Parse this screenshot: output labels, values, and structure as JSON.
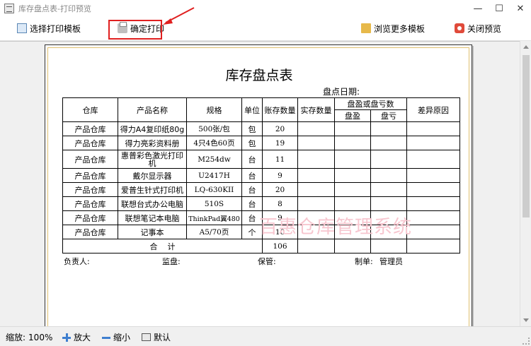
{
  "window": {
    "title": "库存盘点表-打印预览",
    "minimize": "—",
    "maximize": "☐",
    "close": "✕"
  },
  "toolbar": {
    "select_template": "选择打印模板",
    "confirm_print": "确定打印",
    "browse_templates": "浏览更多模板",
    "close_preview": "关闭预览"
  },
  "document": {
    "title": "库存盘点表",
    "date_label": "盘点日期:",
    "headers": {
      "warehouse": "仓库",
      "product": "产品名称",
      "spec": "规格",
      "unit": "单位",
      "book_qty": "账存数量",
      "actual_qty": "实存数量",
      "diff_group": "盘盈或盘亏数",
      "gain": "盘盈",
      "loss": "盘亏",
      "reason": "差异原因"
    },
    "rows": [
      {
        "warehouse": "产品仓库",
        "product": "得力A4复印纸80g",
        "spec": "500张/包",
        "unit": "包",
        "qty": "20"
      },
      {
        "warehouse": "产品仓库",
        "product": "得力亮彩资料册",
        "spec": "4只4色60页",
        "unit": "包",
        "qty": "19"
      },
      {
        "warehouse": "产品仓库",
        "product": "惠普彩色激光打印机",
        "spec": "M254dw",
        "unit": "台",
        "qty": "11"
      },
      {
        "warehouse": "产品仓库",
        "product": "戴尔显示器",
        "spec": "U2417H",
        "unit": "台",
        "qty": "9"
      },
      {
        "warehouse": "产品仓库",
        "product": "爱普生针式打印机",
        "spec": "LQ-630KII",
        "unit": "台",
        "qty": "20"
      },
      {
        "warehouse": "产品仓库",
        "product": "联想台式办公电脑",
        "spec": "510S",
        "unit": "台",
        "qty": "8"
      },
      {
        "warehouse": "产品仓库",
        "product": "联想笔记本电脑",
        "spec": "ThinkPad翼480",
        "unit": "台",
        "qty": "9"
      },
      {
        "warehouse": "产品仓库",
        "product": "记事本",
        "spec": "A5/70页",
        "unit": "个",
        "qty": "10"
      }
    ],
    "total_label": "合    计",
    "total_qty": "106",
    "signatures": {
      "manager": "负责人:",
      "supervisor": "监盘:",
      "keeper": "保管:",
      "maker": "制单:",
      "maker_name": "管理员"
    },
    "watermark": "百惠仓库管理系统"
  },
  "statusbar": {
    "zoom_label": "缩放:",
    "zoom_value": "100%",
    "zoom_in": "放大",
    "zoom_out": "缩小",
    "default": "默认"
  },
  "colors": {
    "highlight": "#e02020",
    "watermark": "#f7c6cf",
    "page_border_inner": "#e0c070"
  }
}
